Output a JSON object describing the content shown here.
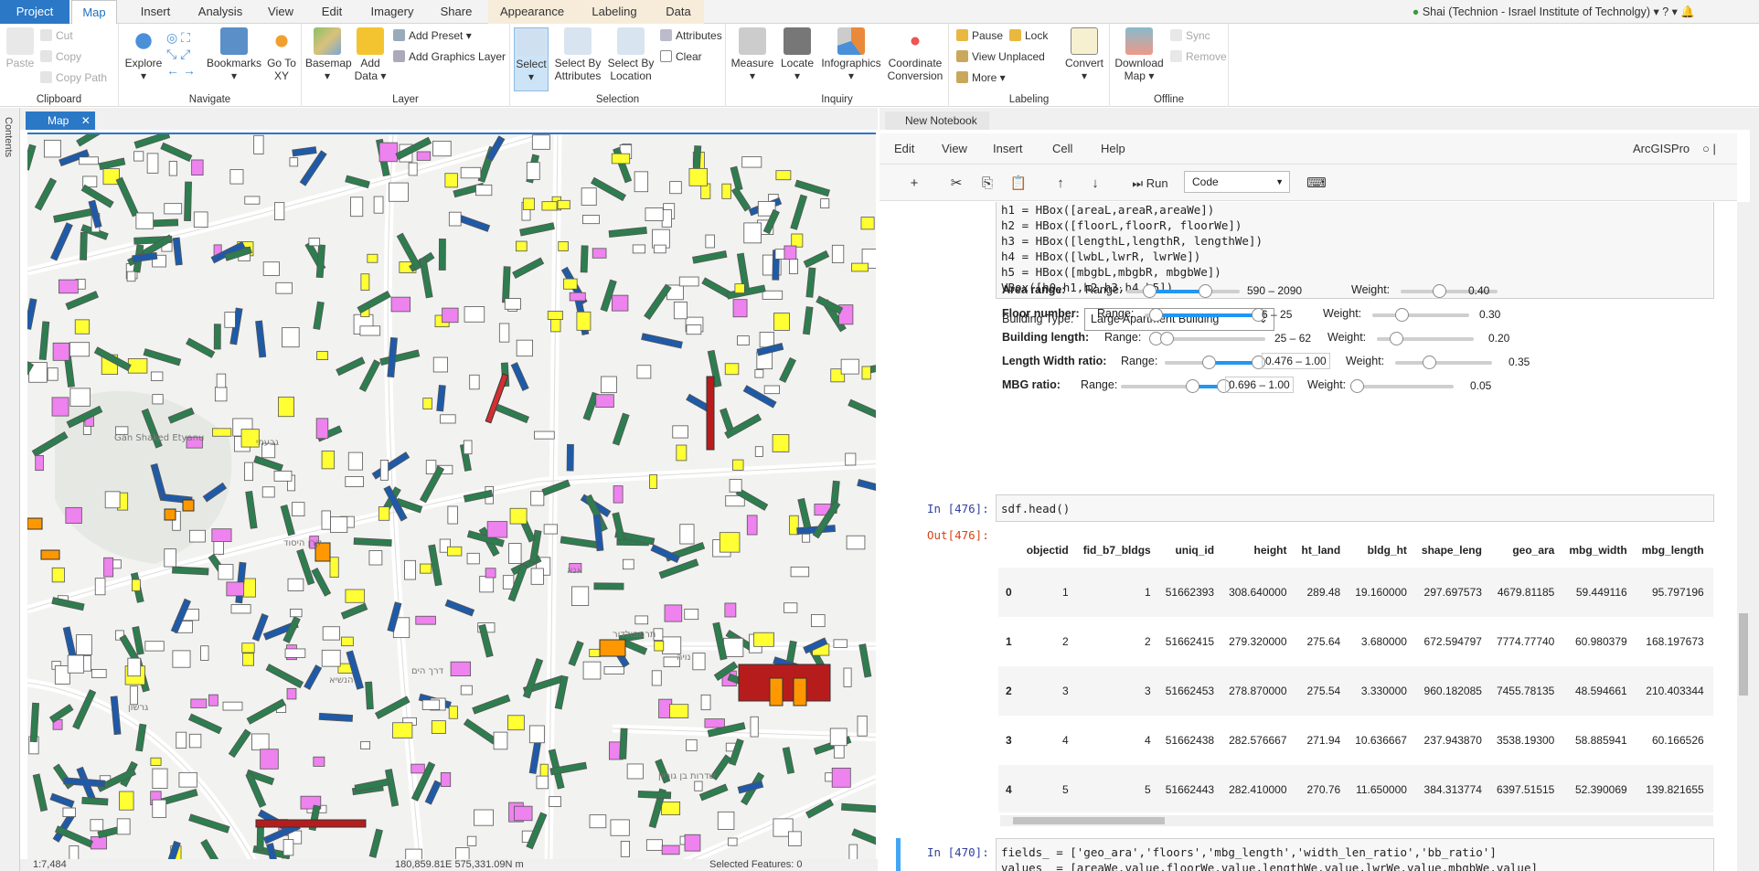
{
  "tabs": [
    "Project",
    "Map",
    "Insert",
    "Analysis",
    "View",
    "Edit",
    "Imagery",
    "Share",
    "Appearance",
    "Labeling",
    "Data"
  ],
  "user": "Shai (Technion - Israel Institute of Technolgy)",
  "ribbon": {
    "clipboard": {
      "label": "Clipboard",
      "paste": "Paste",
      "cut": "Cut",
      "copy": "Copy",
      "copy_path": "Copy Path"
    },
    "navigate": {
      "label": "Navigate",
      "explore": "Explore",
      "bookmarks": "Bookmarks",
      "goto": "Go To XY"
    },
    "layer": {
      "label": "Layer",
      "basemap": "Basemap",
      "add_data": "Add Data",
      "add_preset": "Add Preset",
      "add_graphics": "Add Graphics Layer"
    },
    "selection": {
      "label": "Selection",
      "select": "Select",
      "by_attr": "Select By Attributes",
      "by_loc": "Select By Location",
      "attributes": "Attributes",
      "clear": "Clear"
    },
    "inquiry": {
      "label": "Inquiry",
      "measure": "Measure",
      "locate": "Locate",
      "infographics": "Infographics",
      "coord": "Coordinate Conversion"
    },
    "labeling": {
      "label": "Labeling",
      "pause": "Pause",
      "lock": "Lock",
      "view_unplaced": "View Unplaced",
      "more": "More",
      "convert": "Convert"
    },
    "offline": {
      "label": "Offline",
      "download": "Download Map",
      "sync": "Sync",
      "remove": "Remove"
    }
  },
  "contents_label": "Contents",
  "map_tab": "Map",
  "map_labels": [
    "גבעתי",
    "גרשון",
    "הנשיא",
    "קרן היסוד",
    "דרך הים",
    "תרמפולדור",
    "שדרות בן גוריון",
    "נויה",
    "Gan Shaked Etyanu",
    "אנא"
  ],
  "status": {
    "scale": "1:7,484",
    "coords": "180,859.81E 575,331.09N m",
    "selected": "Selected Features: 0"
  },
  "notebook": {
    "tab": "New Notebook",
    "menu": [
      "Edit",
      "View",
      "Insert",
      "Cell",
      "Help"
    ],
    "kernel": "ArcGISPro",
    "run": "Run",
    "cell_type": "Code",
    "code_lines": [
      "h1 = HBox([areaL,areaR,areaWe])",
      "h2 = HBox([floorL,floorR, floorWe])",
      "h3 = HBox([lengthL,lengthR, lengthWe])",
      "h4 = HBox([lwbL,lwrR, lwrWe])",
      "h5 = HBox([mbgbL,mbgbR, mbgbWe])",
      "VBox([h0,h1,h2,h3,h4,h5])"
    ],
    "building_type_label": "Building Type:",
    "building_type": "Large Apartment Building",
    "widgets": [
      {
        "label": "Area range:",
        "range_label": "Range:",
        "value": "590 – 2090",
        "weight_label": "Weight:",
        "weight": "0.40",
        "lo": 0.2,
        "hi": 0.69,
        "w": 0.4
      },
      {
        "label": "Floor number:",
        "range_label": "Range:",
        "value": "6 – 25",
        "weight_label": "Weight:",
        "weight": "0.30",
        "lo": 0.1,
        "hi": 1.0,
        "w": 0.3
      },
      {
        "label": "Building length:",
        "range_label": "Range:",
        "value": "25 – 62",
        "weight_label": "Weight:",
        "weight": "0.20",
        "lo": 0.03,
        "hi": 0.13,
        "w": 0.2
      },
      {
        "label": "Length Width ratio:",
        "range_label": "Range:",
        "value": "0.476 – 1.00",
        "weight_label": "Weight:",
        "weight": "0.35",
        "lo": 0.47,
        "hi": 1.0,
        "w": 0.35
      },
      {
        "label": "MBG ratio:",
        "range_label": "Range:",
        "value": "0.696 – 1.00",
        "weight_label": "Weight:",
        "weight": "0.05",
        "lo": 0.7,
        "hi": 1.0,
        "w": 0.0
      }
    ],
    "cell2": {
      "in_prompt": "In [476]:",
      "code": "sdf.head()",
      "out_prompt": "Out[476]:"
    },
    "table": {
      "columns": [
        "",
        "objectid",
        "fid_b7_bldgs",
        "uniq_id",
        "height",
        "ht_land",
        "bldg_ht",
        "shape_leng",
        "geo_ara",
        "mbg_width",
        "mbg_length",
        "mbg_"
      ],
      "rows": [
        [
          "0",
          "1",
          "1",
          "51662393",
          "308.640000",
          "289.48",
          "19.160000",
          "297.697573",
          "4679.81185",
          "59.449116",
          "95.797196",
          ""
        ],
        [
          "1",
          "2",
          "2",
          "51662415",
          "279.320000",
          "275.64",
          "3.680000",
          "672.594797",
          "7774.77740",
          "60.980379",
          "168.197673",
          ""
        ],
        [
          "2",
          "3",
          "3",
          "51662453",
          "278.870000",
          "275.54",
          "3.330000",
          "960.182085",
          "7455.78135",
          "48.594661",
          "210.403344",
          ""
        ],
        [
          "3",
          "4",
          "4",
          "51662438",
          "282.576667",
          "271.94",
          "10.636667",
          "237.943870",
          "3538.19300",
          "58.885941",
          "60.166526",
          ""
        ],
        [
          "4",
          "5",
          "5",
          "51662443",
          "282.410000",
          "270.76",
          "11.650000",
          "384.313774",
          "6397.51515",
          "52.390069",
          "139.821655",
          ""
        ]
      ]
    },
    "cell3": {
      "in_prompt": "In [470]:",
      "line1": "fields_ = ['geo_ara','floors','mbg_length','width_len_ratio','bb_ratio']",
      "line2": "values_ = [areaWe.value,floorWe.value,lengthWe.value,lwrWe.value,mbgbWe.value]"
    }
  }
}
